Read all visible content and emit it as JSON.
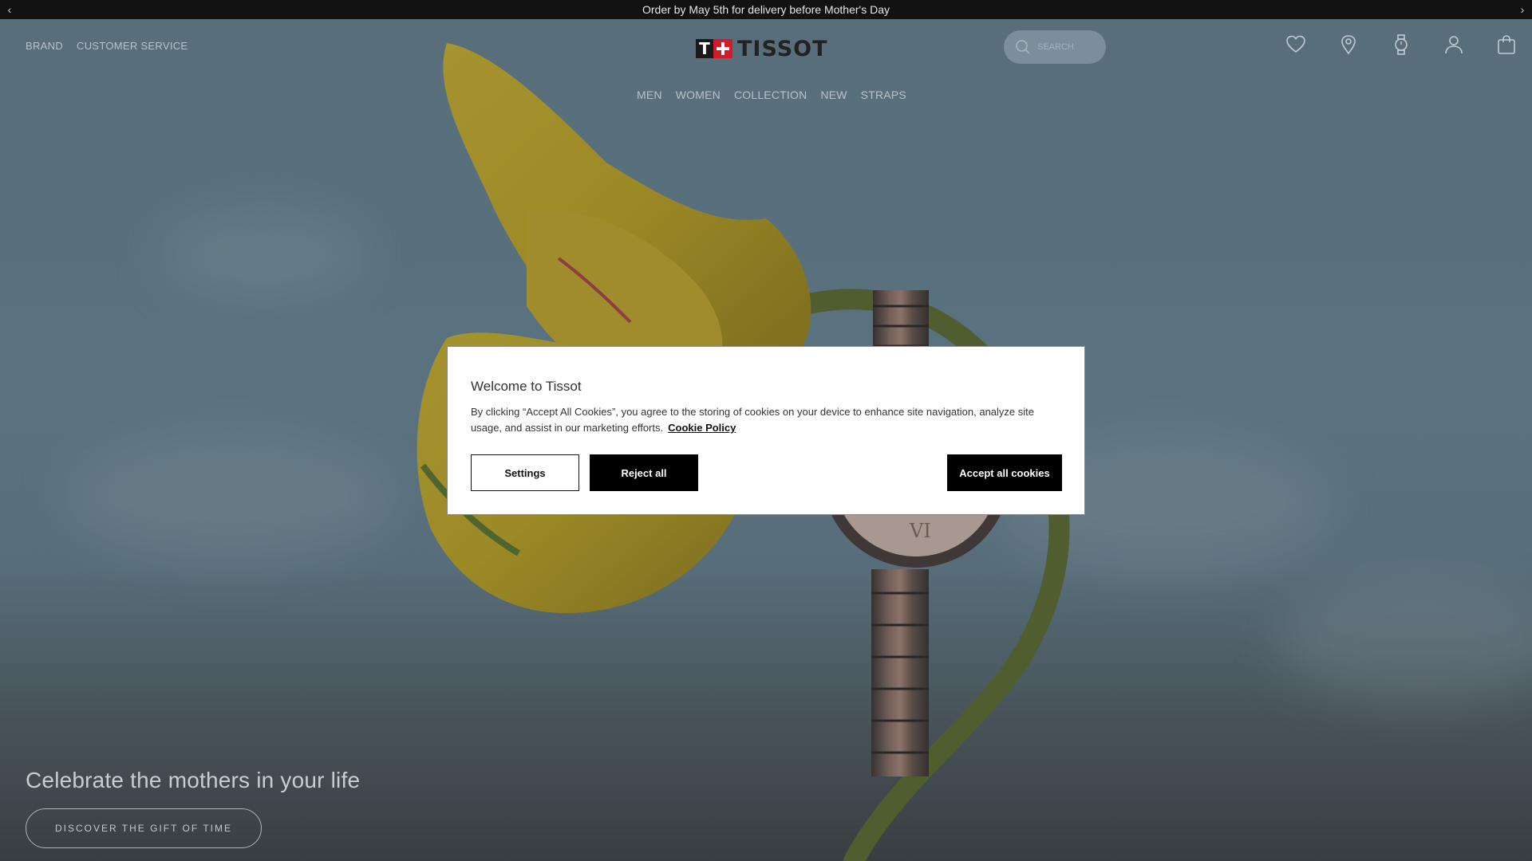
{
  "announcement": {
    "text": "Order by May 5th for delivery before Mother's Day",
    "prev_icon": "chevron-left-icon",
    "next_icon": "chevron-right-icon"
  },
  "header": {
    "utility_links": [
      "BRAND",
      "CUSTOMER SERVICE"
    ],
    "logo_text": "TISSOT",
    "search_placeholder": "SEARCH",
    "icons": [
      "heart-icon",
      "location-pin-icon",
      "watch-icon",
      "user-icon",
      "bag-icon"
    ]
  },
  "main_nav": [
    "MEN",
    "WOMEN",
    "COLLECTION",
    "NEW",
    "STRAPS"
  ],
  "hero": {
    "title": "Celebrate the mothers in your life",
    "cta_label": "DISCOVER THE GIFT OF TIME"
  },
  "cookie_modal": {
    "title": "Welcome to Tissot",
    "body": "By clicking “Accept All Cookies”, you agree to the storing of cookies on your device to enhance site navigation, analyze site usage, and assist in our marketing efforts.",
    "policy_link": "Cookie Policy",
    "settings_label": "Settings",
    "reject_label": "Reject all",
    "accept_label": "Accept all cookies"
  },
  "colors": {
    "announcement_bg": "#121212",
    "brand_red": "#d11a2a",
    "sky": "#6c8797",
    "button_dark": "#000000"
  }
}
